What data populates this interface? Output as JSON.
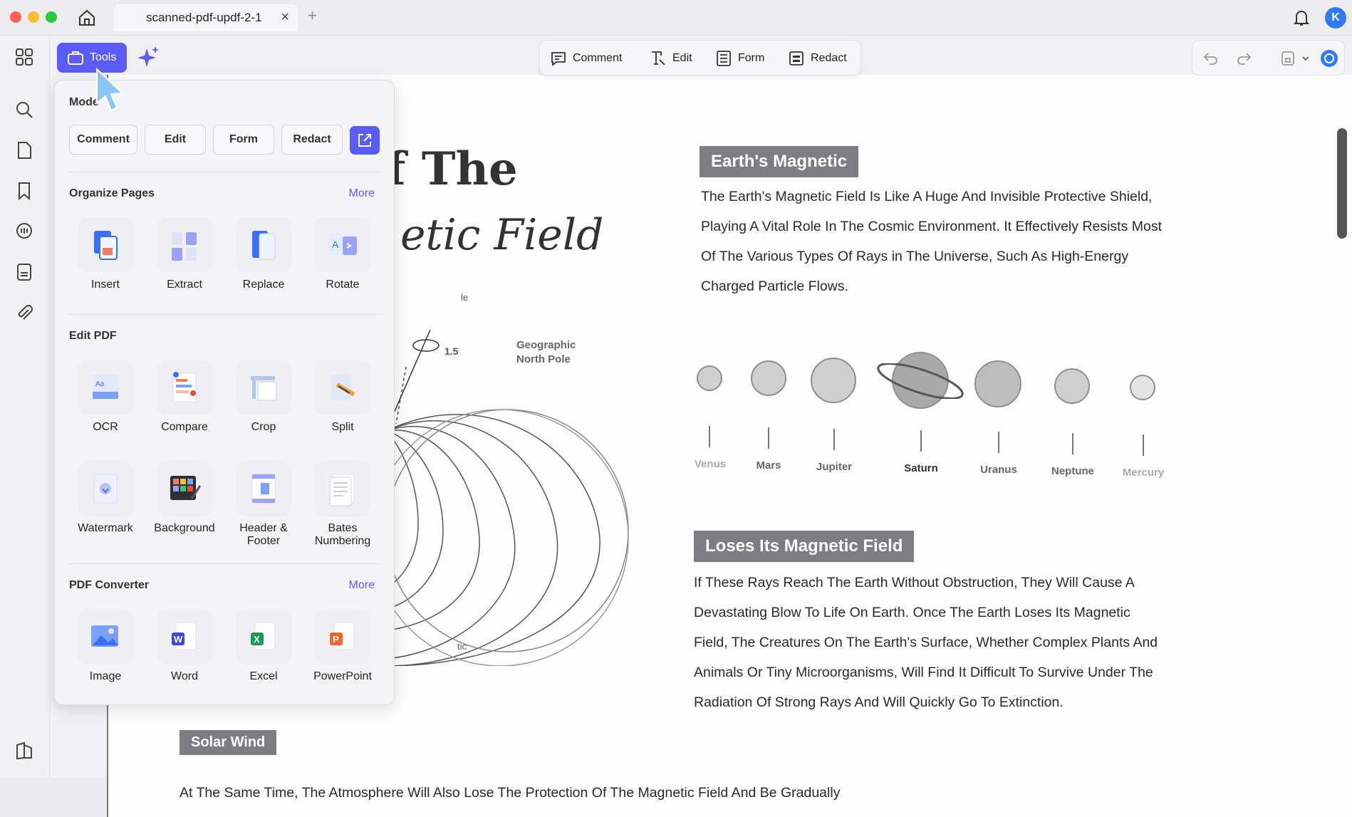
{
  "window": {
    "tab_title": "scanned-pdf-updf-2-1",
    "tab_close": "×",
    "new_tab": "+",
    "avatar_initial": "K"
  },
  "toolbar": {
    "tools_label": "Tools",
    "modes": [
      "Comment",
      "Edit",
      "Form",
      "Redact"
    ]
  },
  "panel": {
    "mode_heading": "Mode",
    "mode_buttons": [
      "Comment",
      "Edit",
      "Form",
      "Redact"
    ],
    "organize": {
      "title": "Organize Pages",
      "more": "More",
      "items": [
        "Insert",
        "Extract",
        "Replace",
        "Rotate"
      ]
    },
    "edit": {
      "title": "Edit PDF",
      "items": [
        "OCR",
        "Compare",
        "Crop",
        "Split",
        "Watermark",
        "Background",
        "Header & Footer",
        "Bates Numbering"
      ]
    },
    "converter": {
      "title": "PDF Converter",
      "more": "More",
      "items": [
        "Image",
        "Word",
        "Excel",
        "PowerPoint"
      ]
    }
  },
  "document": {
    "title_line1_fragment": "f The",
    "title_line2_fragment": "etic Field",
    "diagram_label_pole": "Geographic\nNorth Pole",
    "diagram_angle": "1.5",
    "diagram_fragment_le": "le",
    "diagram_fragment_tic": "tic",
    "section1_title": "Earth's Magnetic",
    "section1_body": [
      "The Earth's Magnetic Field Is Like A Huge And Invisible Protective Shield,",
      "Playing A Vital Role In The Cosmic Environment. It Effectively Resists Most",
      "Of The Various Types Of Rays in The Universe, Such As High-Energy",
      "Charged Particle Flows."
    ],
    "planets": [
      "Venus",
      "Mars",
      "Jupiter",
      "Saturn",
      "Uranus",
      "Neptune",
      "Mercury"
    ],
    "section2_title": "Loses Its Magnetic Field",
    "section2_body": [
      "If These Rays Reach The Earth Without Obstruction, They Will Cause A",
      "Devastating Blow To Life On Earth. Once The Earth Loses Its Magnetic",
      "Field, The Creatures On The Earth's Surface, Whether Complex Plants And",
      "Animals Or Tiny Microorganisms, Will Find It Difficult To Survive Under The",
      "Radiation Of Strong Rays And Will Quickly Go To Extinction."
    ],
    "solar_wind": "Solar Wind",
    "bottom_line": "At The Same Time, The Atmosphere Will Also Lose The Protection Of The Magnetic Field And Be Gradually"
  },
  "colors": {
    "accent": "#5b5cf6",
    "avatar": "#2f7bf6"
  }
}
